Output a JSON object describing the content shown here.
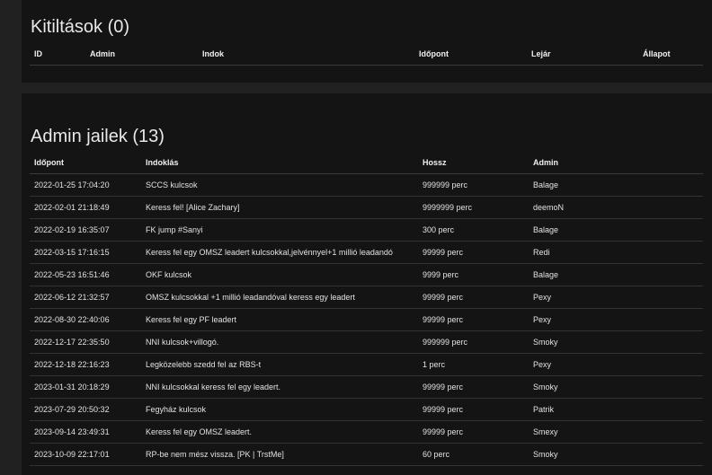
{
  "bans": {
    "title": "Kitiltások (0)",
    "columns": [
      "ID",
      "Admin",
      "Indok",
      "Időpont",
      "Lejár",
      "Állapot"
    ],
    "rows": []
  },
  "jails": {
    "title": "Admin jailek (13)",
    "columns": [
      "Időpont",
      "Indoklás",
      "Hossz",
      "Admin"
    ],
    "rows": [
      [
        "2022-01-25 17:04:20",
        "SCCS kulcsok",
        "999999 perc",
        "Balage"
      ],
      [
        "2022-02-01 21:18:49",
        "Keress fel! [Alice Zachary]",
        "9999999 perc",
        "deemoN"
      ],
      [
        "2022-02-19 16:35:07",
        "FK jump #Sanyi",
        "300 perc",
        "Balage"
      ],
      [
        "2022-03-15 17:16:15",
        "Keress fel egy OMSZ leadert kulcsokkal,jelvénnyel+1 millió leadandó",
        "99999 perc",
        "Redi"
      ],
      [
        "2022-05-23 16:51:46",
        "OKF kulcsok",
        "9999 perc",
        "Balage"
      ],
      [
        "2022-06-12 21:32:57",
        "OMSZ kulcsokkal +1 millió leadandóval keress egy leadert",
        "99999 perc",
        "Pexy"
      ],
      [
        "2022-08-30 22:40:06",
        "Keress fel egy PF leadert",
        "99999 perc",
        "Pexy"
      ],
      [
        "2022-12-17 22:35:50",
        "NNI kulcsok+villogó.",
        "999999 perc",
        "Smoky"
      ],
      [
        "2022-12-18 22:16:23",
        "Legközelebb szedd fel az RBS-t",
        "1 perc",
        "Pexy"
      ],
      [
        "2023-01-31 20:18:29",
        "NNI kulcsokkal keress fel egy leadert.",
        "99999 perc",
        "Smoky"
      ],
      [
        "2023-07-29 20:50:32",
        "Fegyház kulcsok",
        "99999 perc",
        "Patrik"
      ],
      [
        "2023-09-14 23:49:31",
        "Keress fel egy OMSZ leadert.",
        "99999 perc",
        "Smexy"
      ],
      [
        "2023-10-09 22:17:01",
        "RP-be nem mész vissza. [PK | TrstMe]",
        "60 perc",
        "Smoky"
      ]
    ]
  }
}
